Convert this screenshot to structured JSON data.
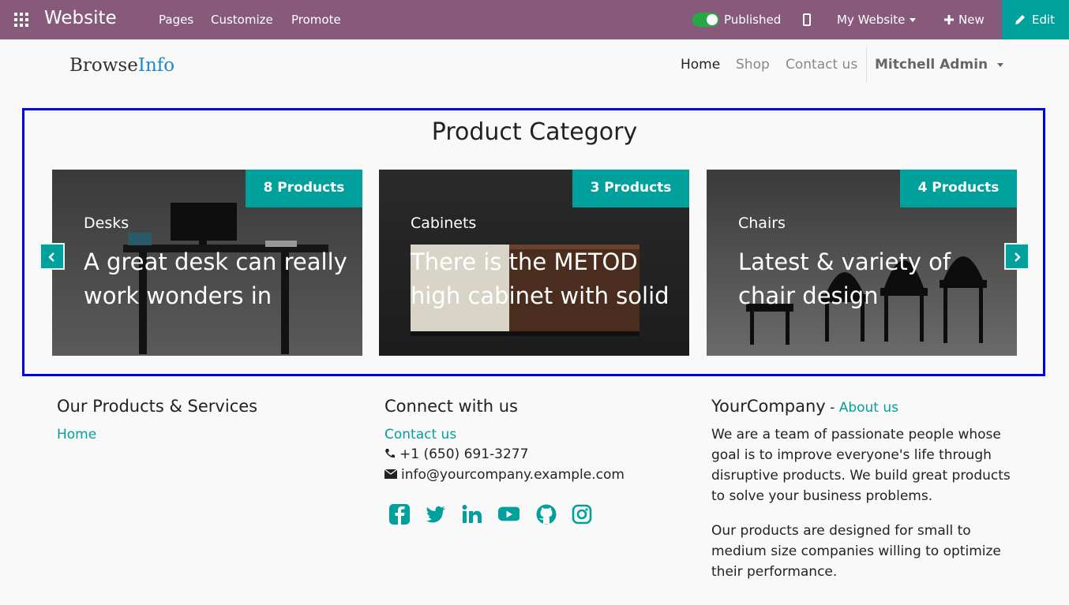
{
  "topbar": {
    "app_title": "Website",
    "menu": [
      "Pages",
      "Customize",
      "Promote"
    ],
    "published_label": "Published",
    "published_on": true,
    "site_selector": "My Website",
    "new_label": "New",
    "edit_label": "Edit"
  },
  "site": {
    "logo_part1": "Browse",
    "logo_part2": "Info",
    "nav": [
      "Home",
      "Shop",
      "Contact us"
    ],
    "user": "Mitchell Admin"
  },
  "category_section": {
    "title": "Product Category",
    "cards": [
      {
        "badge": "8 Products",
        "name": "Desks",
        "desc": "A great desk can really work wonders in"
      },
      {
        "badge": "3 Products",
        "name": "Cabinets",
        "desc": "There is the METOD high cabinet with solid"
      },
      {
        "badge": "4 Products",
        "name": "Chairs",
        "desc": "Latest & variety of chair design"
      }
    ]
  },
  "footer": {
    "products_title": "Our Products & Services",
    "products_link": "Home",
    "connect_title": "Connect with us",
    "contact_link": "Contact us",
    "phone": "+1 (650) 691-3277",
    "email": "info@yourcompany.example.com",
    "social_icons": [
      "facebook-icon",
      "twitter-icon",
      "linkedin-icon",
      "youtube-icon",
      "github-icon",
      "instagram-icon"
    ],
    "company_name": "YourCompany",
    "about_sep": " - ",
    "about_link": "About us",
    "about_p1": "We are a team of passionate people whose goal is to improve everyone's life through disruptive products. We build great products to solve your business problems.",
    "about_p2": "Our products are designed for small to medium size companies willing to optimize their performance."
  },
  "colors": {
    "topbar": "#875a7b",
    "accent": "#00a09d",
    "highlight_box": "#0000e6"
  }
}
